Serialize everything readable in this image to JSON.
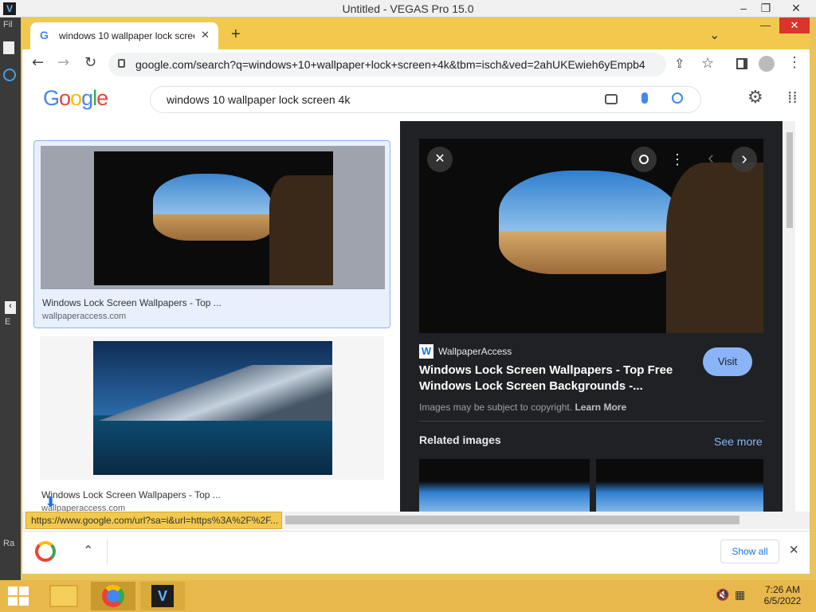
{
  "vegas": {
    "title": "Untitled - VEGAS Pro 15.0",
    "logo": "V",
    "menu_partial": "Fil",
    "left_letters": [
      "E",
      "Ra"
    ]
  },
  "chrome": {
    "tab_title": "windows 10 wallpaper lock scree",
    "url": "google.com/search?q=windows+10+wallpaper+lock+screen+4k&tbm=isch&ved=2ahUKEwieh6yEmpb4A...",
    "status_url": "https://www.google.com/url?sa=i&url=https%3A%2F%2F...",
    "downloads_show_all": "Show all"
  },
  "google": {
    "logo": [
      "G",
      "o",
      "o",
      "g",
      "l",
      "e"
    ],
    "logo_colors": [
      "#4285f4",
      "#ea4335",
      "#fbbc05",
      "#4285f4",
      "#34a853",
      "#ea4335"
    ],
    "query": "windows 10 wallpaper lock screen 4k"
  },
  "results": [
    {
      "title": "Windows Lock Screen Wallpapers - Top ...",
      "source": "wallpaperaccess.com"
    },
    {
      "title": "Windows Lock Screen Wallpapers - Top ...",
      "source": "wallpaperaccess.com"
    }
  ],
  "panel": {
    "site_name": "WallpaperAccess",
    "site_icon": "W",
    "title_line1": "Windows Lock Screen Wallpapers - Top Free",
    "title_line2": "Windows Lock Screen Backgrounds -...",
    "visit": "Visit",
    "copyright": "Images may be subject to copyright.",
    "learn_more": "Learn More",
    "related": "Related images",
    "see_more": "See more"
  },
  "taskbar": {
    "time": "7:26 AM",
    "date": "6/5/2022"
  },
  "icons": {
    "close": "✕",
    "newtab": "+",
    "back": "←",
    "forward": "→",
    "reload": "↻",
    "star": "☆",
    "chevron_down": "⌄",
    "chevron_up": "⌃",
    "prev": "‹",
    "next": "›",
    "more": "⋮"
  }
}
